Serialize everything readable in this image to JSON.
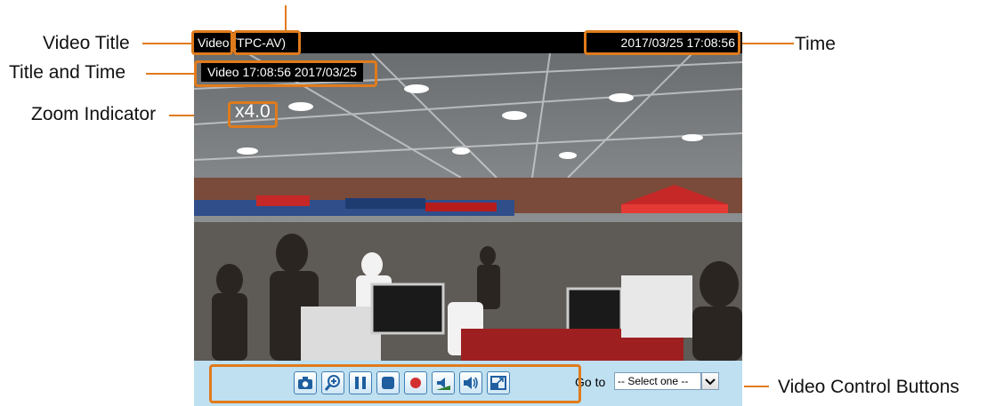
{
  "callouts": {
    "video_title": "Video Title",
    "title_and_time": "Title and Time",
    "zoom_indicator": "Zoom Indicator",
    "time": "Time",
    "video_control_buttons": "Video Control Buttons"
  },
  "viewer": {
    "title_prefix": "Video",
    "title_name": "(TPC-AV)",
    "datetime": "2017/03/25  17:08:56",
    "overlay_title_time": "Video 17:08:56  2017/03/25",
    "zoom": "x4.0"
  },
  "controls": {
    "buttons": [
      {
        "icon": "camera-icon",
        "action": "snapshot"
      },
      {
        "icon": "zoom-in-icon",
        "action": "digital-zoom"
      },
      {
        "icon": "pause-icon",
        "action": "pause"
      },
      {
        "icon": "stop-icon",
        "action": "stop"
      },
      {
        "icon": "record-icon",
        "action": "record"
      },
      {
        "icon": "volume-mute-icon",
        "action": "mute"
      },
      {
        "icon": "volume-icon",
        "action": "volume"
      },
      {
        "icon": "fullscreen-icon",
        "action": "full-screen"
      }
    ],
    "goto_label": "Go to",
    "goto_selected": "-- Select one --"
  },
  "colors": {
    "accent": "#e07b1c",
    "control_bar": "#bfe0f0"
  }
}
